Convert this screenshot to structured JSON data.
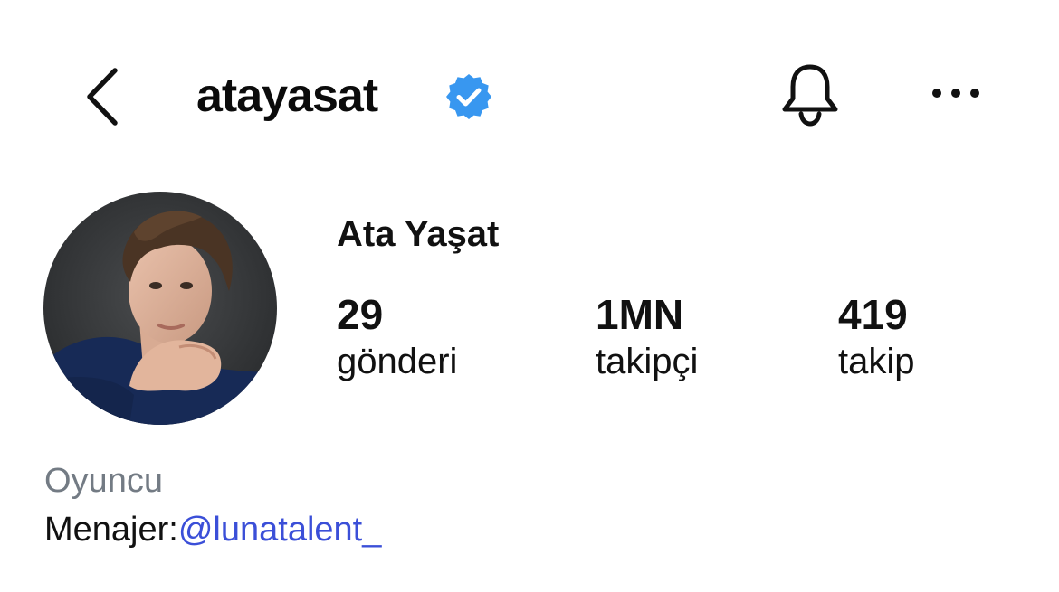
{
  "header": {
    "back_icon": "chevron-left-icon",
    "username": "atayasat",
    "verified_icon": "verified-badge-icon",
    "verified_color": "#3897f0",
    "bell_icon": "bell-icon",
    "more_icon": "more-horizontal-icon"
  },
  "profile": {
    "avatar_icon": "profile-photo",
    "display_name": "Ata Yaşat",
    "stats": [
      {
        "value": "29",
        "label": "gönderi"
      },
      {
        "value": "1MN",
        "label": "takipçi"
      },
      {
        "value": "419",
        "label": "takip"
      }
    ]
  },
  "bio": {
    "category": "Oyuncu",
    "manager_prefix": "Menajer:",
    "manager_link": "@lunatalent_",
    "link_color": "#3b4fd8",
    "category_color": "#737b84"
  }
}
